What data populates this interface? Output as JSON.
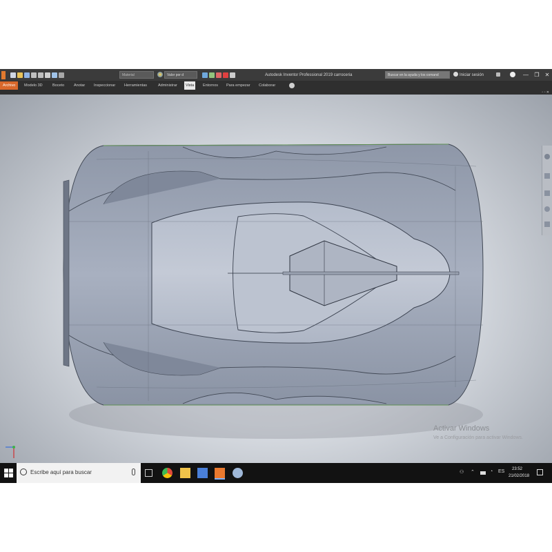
{
  "titlebar": {
    "app_title": "Autodesk Inventor Professional 2019   carroceria",
    "qat_material_placeholder": "Material",
    "qat_appearance_value": "Valor por d",
    "help_search_placeholder": "Buscar en la ayuda y los comand",
    "signin_label": "Iniciar sesión",
    "minimize_glyph": "—",
    "restore_glyph": "❐",
    "close_glyph": "✕"
  },
  "ribbon": {
    "tabs": [
      "Archivo",
      "Modelo 3D",
      "Boceto",
      "Anotar",
      "Inspeccionar",
      "Herramientas",
      "Administrar",
      "Vista",
      "Entornos",
      "Para empezar",
      "Colaborar"
    ],
    "active_tab": "Vista"
  },
  "viewport": {
    "watermark_title": "Activar Windows",
    "watermark_subtitle": "Ve a Configuración para activar Windows.",
    "model_description": "car body top view wireframe"
  },
  "taskbar": {
    "search_placeholder": "Escribe aquí para buscar",
    "time": "23:52",
    "date": "21/02/2018",
    "language": "ES"
  },
  "colors": {
    "titlebar_bg": "#3b3b3b",
    "file_tab": "#d9682b",
    "model_fill": "#9ba3b3",
    "taskbar_bg": "#121212"
  }
}
